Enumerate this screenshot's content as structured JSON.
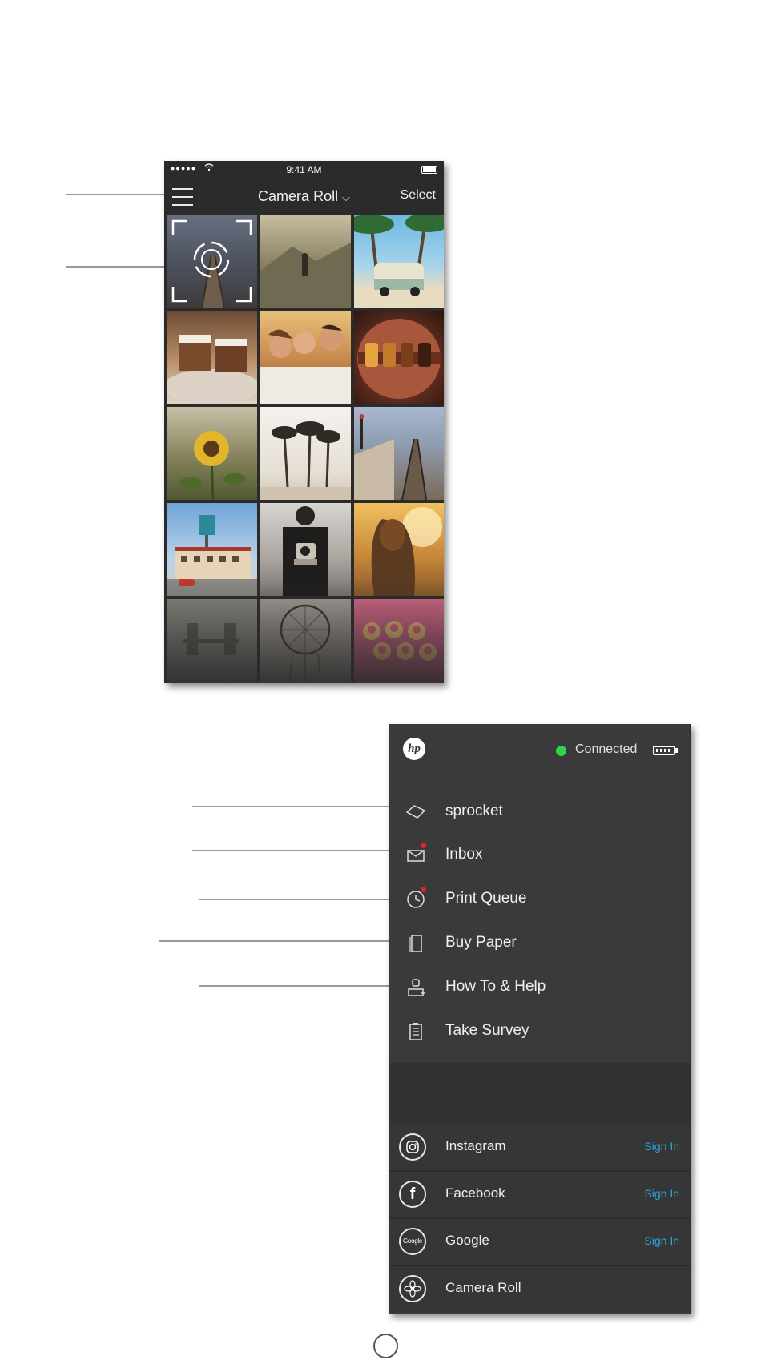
{
  "status_bar": {
    "signal": "●●●●●",
    "time": "9:41 AM"
  },
  "nav_bar": {
    "title": "Camera Roll",
    "chevron": "⌵",
    "select_label": "Select"
  },
  "photo_grid": {
    "photos": [
      "scan-capture",
      "hiker-mountains",
      "vw-van-palms",
      "cake-slices",
      "friends-selfie",
      "beer-flight",
      "sunflower",
      "palm-trees",
      "railroad-coast",
      "retro-motel",
      "camera-person",
      "field-girl",
      "tower-bridge",
      "dreamcatcher",
      "cupcakes"
    ]
  },
  "menu": {
    "logo": "hp",
    "connection_status": "Connected",
    "status_color": "#2ed34a",
    "items": [
      {
        "label": "sprocket",
        "icon": "sprocket-icon",
        "badge": false
      },
      {
        "label": "Inbox",
        "icon": "envelope-icon",
        "badge": true
      },
      {
        "label": "Print Queue",
        "icon": "clock-icon",
        "badge": true
      },
      {
        "label": "Buy Paper",
        "icon": "paper-icon",
        "badge": false
      },
      {
        "label": "How To & Help",
        "icon": "help-icon",
        "badge": false
      },
      {
        "label": "Take Survey",
        "icon": "clipboard-icon",
        "badge": false
      }
    ],
    "social": [
      {
        "label": "Instagram",
        "action": "Sign In",
        "icon": "instagram-icon"
      },
      {
        "label": "Facebook",
        "action": "Sign In",
        "icon": "facebook-icon",
        "glyph": "f"
      },
      {
        "label": "Google",
        "action": "Sign In",
        "icon": "google-icon",
        "glyph": "Google"
      },
      {
        "label": "Camera Roll",
        "icon": "camera-roll-icon"
      }
    ],
    "accent_color": "#26a8dd",
    "badge_color": "#e0232a"
  }
}
